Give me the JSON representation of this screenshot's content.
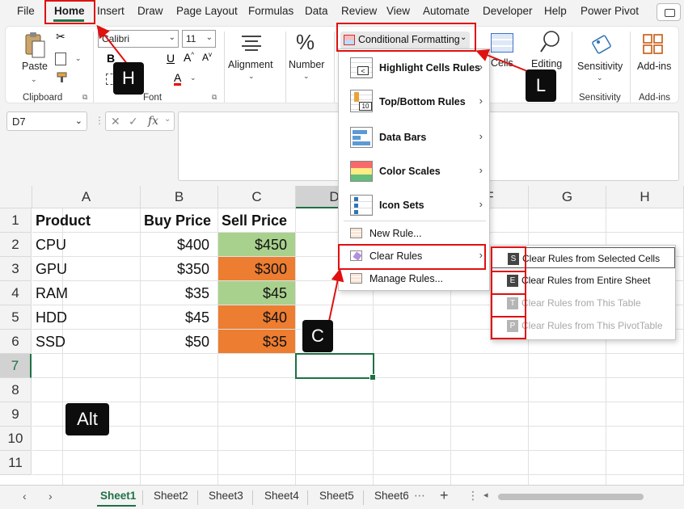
{
  "menubar": {
    "tabs": [
      "File",
      "Home",
      "Insert",
      "Draw",
      "Page Layout",
      "Formulas",
      "Data",
      "Review",
      "View",
      "Automate",
      "Developer",
      "Help",
      "Power Pivot"
    ],
    "active": "Home"
  },
  "ribbon": {
    "clipboard": {
      "paste_label": "Paste",
      "group_label": "Clipboard"
    },
    "font": {
      "font_name": "Calibri",
      "font_size": "11",
      "bold": "B",
      "underline": "U",
      "group_label": "Font"
    },
    "alignment_label": "Alignment",
    "number": {
      "label": "Number",
      "symbol": "%"
    },
    "conditional_formatting_label": "Conditional Formatting",
    "cells_label": "Cells",
    "editing_label": "Editing",
    "sensitivity": {
      "label": "Sensitivity",
      "group_label": "Sensitivity"
    },
    "addins": {
      "label": "Add-ins",
      "group_label": "Add-ins"
    }
  },
  "formula_bar": {
    "name_box": "D7",
    "fx": "fx",
    "cancel": "✕",
    "enter": "✓"
  },
  "grid": {
    "columns": [
      "A",
      "B",
      "C",
      "D",
      "E",
      "F",
      "G",
      "H"
    ],
    "rows": [
      "1",
      "2",
      "3",
      "4",
      "5",
      "6",
      "7",
      "8",
      "9",
      "10",
      "11"
    ],
    "headers": {
      "product": "Product",
      "buy": "Buy Price",
      "sell": "Sell Price"
    },
    "data": [
      {
        "product": "CPU",
        "buy": "$400",
        "sell": "$450",
        "status": "green"
      },
      {
        "product": "GPU",
        "buy": "$350",
        "sell": "$300",
        "status": "orange"
      },
      {
        "product": "RAM",
        "buy": "$35",
        "sell": "$45",
        "status": "green"
      },
      {
        "product": "HDD",
        "buy": "$45",
        "sell": "$40",
        "status": "orange"
      },
      {
        "product": "SSD",
        "buy": "$50",
        "sell": "$35",
        "status": "orange"
      }
    ],
    "selected_cell": "D7"
  },
  "sheet_tabs": {
    "tabs": [
      "Sheet1",
      "Sheet2",
      "Sheet3",
      "Sheet4",
      "Sheet5",
      "Sheet6"
    ],
    "active": "Sheet1",
    "add": "+"
  },
  "cf_menu": {
    "items": [
      {
        "label": "Highlight Cells Rules",
        "icon": "highlight-cells-icon"
      },
      {
        "label": "Top/Bottom Rules",
        "icon": "top-bottom-icon"
      },
      {
        "label": "Data Bars",
        "icon": "data-bars-icon"
      },
      {
        "label": "Color Scales",
        "icon": "color-scales-icon"
      },
      {
        "label": "Icon Sets",
        "icon": "icon-sets-icon"
      }
    ],
    "new_rule": "New Rule...",
    "clear_rules": "Clear Rules",
    "manage_rules": "Manage Rules..."
  },
  "clear_submenu": {
    "items": [
      {
        "key": "S",
        "label": "Clear Rules from Selected Cells",
        "enabled": true
      },
      {
        "key": "E",
        "label": "Clear Rules from Entire Sheet",
        "enabled": true
      },
      {
        "key": "T",
        "label": "Clear Rules from This Table",
        "enabled": false
      },
      {
        "key": "P",
        "label": "Clear Rules from This PivotTable",
        "enabled": false
      }
    ]
  },
  "key_tips": {
    "alt": "Alt",
    "h": "H",
    "l": "L",
    "c": "C"
  },
  "colors": {
    "accent": "#1e7145",
    "highlight_red": "#e01010",
    "good": "#a9d18e",
    "bad": "#ed7d31"
  }
}
